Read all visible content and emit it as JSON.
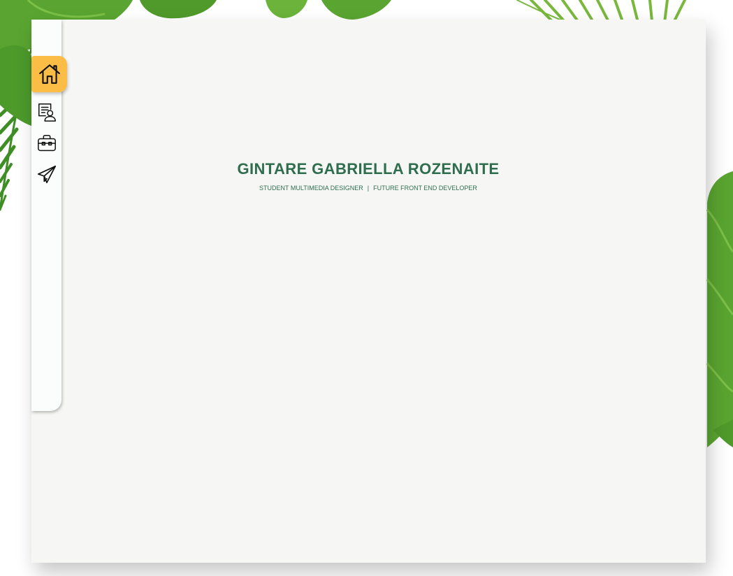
{
  "hero": {
    "name": "GINTARE GABRIELLA ROZENAITE",
    "role_primary": "STUDENT MULTIMEDIA DESIGNER",
    "separator": "|",
    "role_secondary": "FUTURE FRONT END DEVELOPER"
  },
  "nav": {
    "items": [
      {
        "icon": "home-icon",
        "active": true
      },
      {
        "icon": "resume-icon",
        "active": false
      },
      {
        "icon": "briefcase-icon",
        "active": false
      },
      {
        "icon": "paper-plane-icon",
        "active": false
      }
    ]
  },
  "colors": {
    "accent": "#fbbd46",
    "title": "#2e6e4f",
    "card_background": "#f6f6f4",
    "sidebar_background": "#fbfcfc",
    "leaf_green": "#4f9a2a"
  }
}
